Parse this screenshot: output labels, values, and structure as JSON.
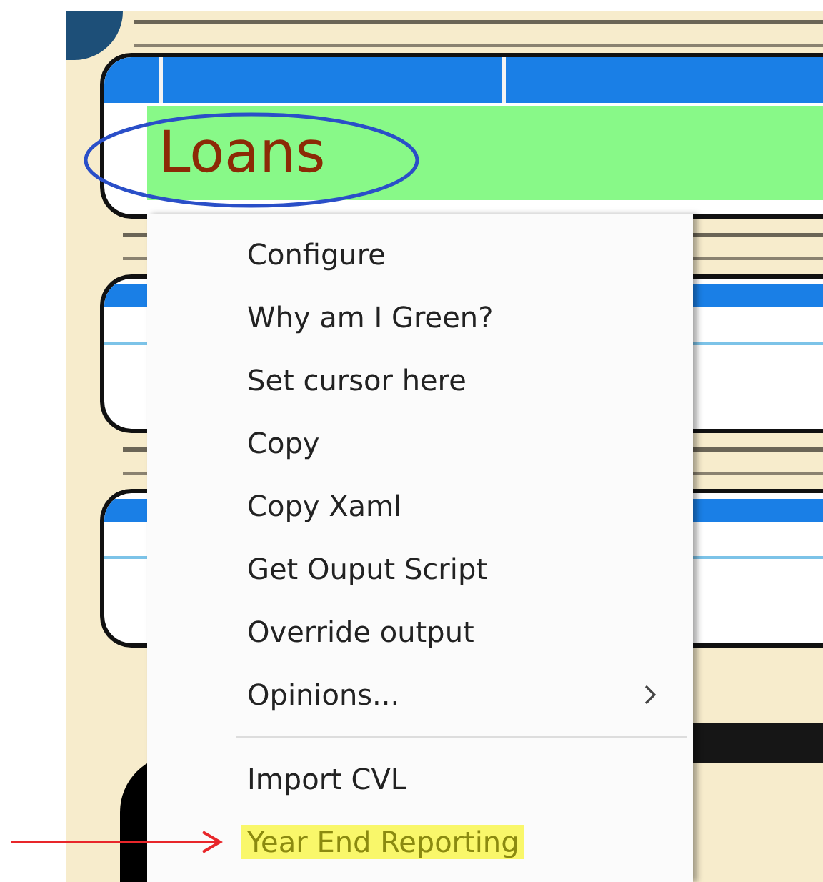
{
  "panel": {
    "title": "Loans"
  },
  "context_menu": {
    "items": [
      {
        "kind": "item",
        "label": "Configure",
        "highlighted": false
      },
      {
        "kind": "item",
        "label": "Why am I Green?",
        "highlighted": false
      },
      {
        "kind": "item",
        "label": "Set cursor here",
        "highlighted": false
      },
      {
        "kind": "item",
        "label": "Copy",
        "highlighted": false
      },
      {
        "kind": "item",
        "label": "Copy Xaml",
        "highlighted": false
      },
      {
        "kind": "item",
        "label": "Get Ouput Script",
        "highlighted": false
      },
      {
        "kind": "item",
        "label": "Override output",
        "highlighted": false
      },
      {
        "kind": "submenu",
        "label": "Opinions...",
        "highlighted": false
      },
      {
        "kind": "separator"
      },
      {
        "kind": "item",
        "label": "Import CVL",
        "highlighted": false
      },
      {
        "kind": "item",
        "label": "Year End Reporting",
        "highlighted": true
      }
    ]
  }
}
